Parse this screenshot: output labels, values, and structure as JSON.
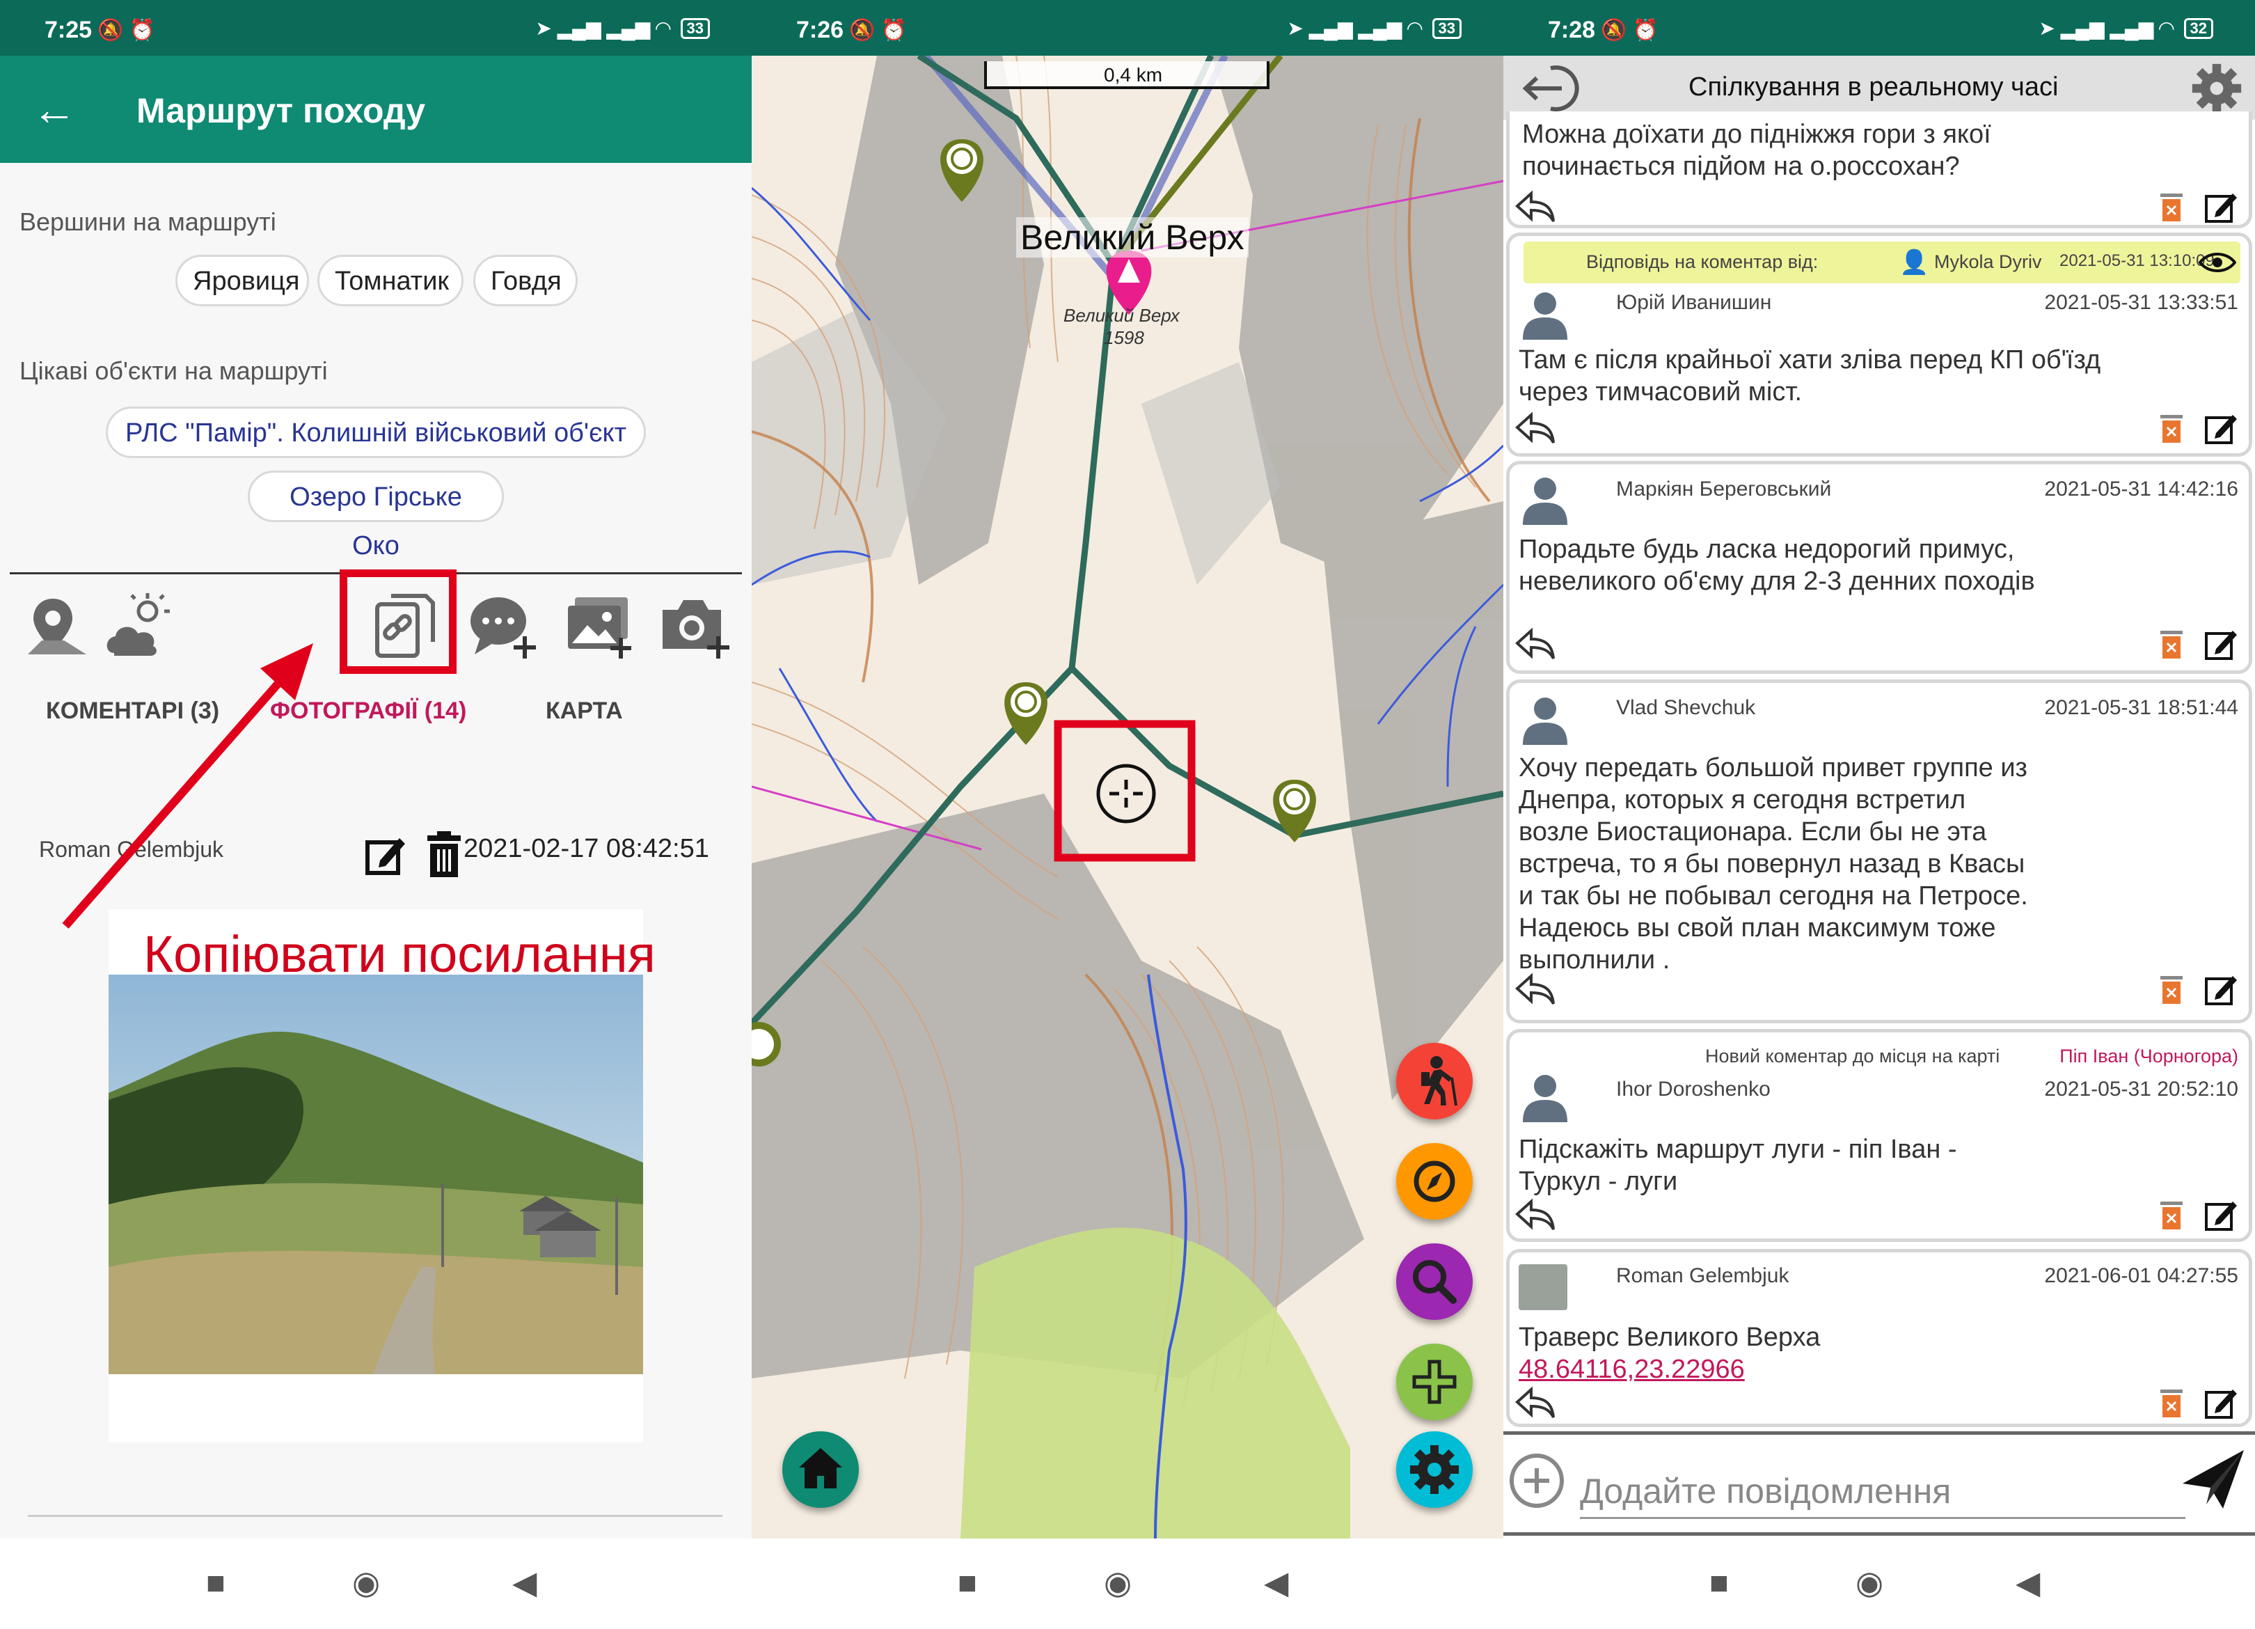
{
  "p1": {
    "status": {
      "time": "7:25",
      "battery": "33"
    },
    "appbar": {
      "back": "←",
      "title": "Маршрут походу"
    },
    "peaks": {
      "label": "Вершини на маршруті",
      "items": [
        "Яровиця",
        "Томнатик",
        "Говдя"
      ]
    },
    "objects": {
      "label": "Цікаві об'єкти на маршруті",
      "items": [
        "РЛС \"Памір\". Колишній військовий об'єкт",
        "Озеро Гірське Око"
      ]
    },
    "tabs": [
      "КОМЕНТАРІ (3)",
      "ФОТОГРАФІЇ (14)",
      "КАРТА"
    ],
    "photo": {
      "author": "Roman Gelembjuk",
      "timestamp": "2021-02-17 08:42:51"
    },
    "annotation": "Копіювати посилання"
  },
  "p2": {
    "status": {
      "time": "7:26",
      "battery": "33"
    },
    "scale": "0,4 km",
    "peak_label": "Великий Верх",
    "map_text": [
      "Великий Верх",
      "1598"
    ]
  },
  "p3": {
    "status": {
      "time": "7:28",
      "battery": "32"
    },
    "title": "Спілкування в реальному часі",
    "messages": [
      {
        "text": "Можна доїхати до підніжжя гори з якої починається підйом на о.россохан?"
      },
      {
        "reply_label": "Відповідь на коментар від:",
        "reply_user": "Mykola Dyriv",
        "reply_date": "2021-05-31 13:10:09",
        "user": "Юрій Иванишин",
        "date": "2021-05-31 13:33:51",
        "text": "Там є після крайньої хати зліва перед КП об'їзд через тимчасовий міст."
      },
      {
        "user": "Маркіян Береговський",
        "date": "2021-05-31 14:42:16",
        "text": "Порадьте будь ласка недорогий примус, невеликого об'єму для 2-3 денних походів"
      },
      {
        "user": "Vlad Shevchuk",
        "date": "2021-05-31 18:51:44",
        "text": "Хочу передать большой привет группе из Днепра, которых я сегодня встретил возле Биостационара. Если бы не эта встреча, то я бы повернул назад в Квасы и так бы не побывал сегодня на Петросе. Надеюсь вы свой план максимум тоже выполнили ."
      },
      {
        "context_label": "Новий коментар до місця на карті",
        "context_place": "Піп Іван (Чорногора)",
        "user": "Ihor Doroshenko",
        "date": "2021-05-31 20:52:10",
        "text": "Підскажіть маршрут луги - піп Іван - Туркул - луги"
      },
      {
        "user": "Roman Gelembjuk",
        "date": "2021-06-01 04:27:55",
        "text": "Траверс Великого Верха",
        "link": "48.64116,23.22966"
      }
    ],
    "composer_placeholder": "Додайте повідомлення"
  },
  "colors": {
    "appbar": "#0f8a73",
    "statusbar": "#0b6b58",
    "accent": "#c2185b",
    "highlight": "#e0001b"
  },
  "icons": [
    "back-arrow-icon",
    "map-pin-icon",
    "weather-icon",
    "copy-link-icon",
    "add-comment-icon",
    "add-photo-icon",
    "camera-add-icon",
    "edit-icon",
    "trash-icon",
    "hiker-icon",
    "compass-icon",
    "search-icon",
    "plus-icon",
    "gear-icon",
    "home-icon",
    "crosshair-icon",
    "reply-icon",
    "send-icon",
    "eye-icon",
    "exit-icon"
  ]
}
